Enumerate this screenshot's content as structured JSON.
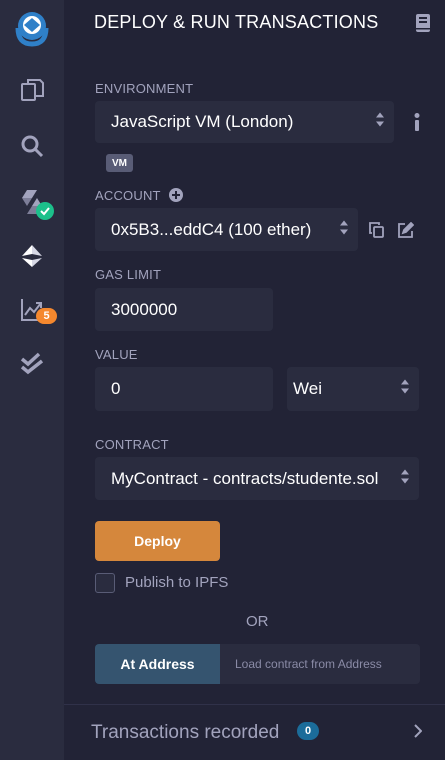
{
  "sidebar": {
    "icons": [
      "remix-logo-icon",
      "file-explorer-icon",
      "search-icon",
      "solidity-compiler-icon",
      "deploy-run-icon",
      "analysis-icon",
      "test-icon"
    ],
    "compiler_status": "check",
    "analysis_badge": "5"
  },
  "header": {
    "title": "DEPLOY & RUN TRANSACTIONS"
  },
  "environment": {
    "label": "ENVIRONMENT",
    "value": "JavaScript VM (London)",
    "badge": "VM"
  },
  "account": {
    "label": "ACCOUNT",
    "value": "0x5B3...eddC4 (100 ether)"
  },
  "gas_limit": {
    "label": "GAS LIMIT",
    "value": "3000000"
  },
  "value": {
    "label": "VALUE",
    "amount": "0",
    "unit": "Wei"
  },
  "contract": {
    "label": "CONTRACT",
    "value": "MyContract - contracts/studente.sol"
  },
  "deploy": {
    "button_label": "Deploy",
    "publish_label": "Publish to IPFS",
    "publish_checked": false
  },
  "or_label": "OR",
  "at_address": {
    "button_label": "At Address",
    "placeholder": "Load contract from Address"
  },
  "transactions": {
    "label": "Transactions recorded",
    "count": "0"
  },
  "colors": {
    "background": "#222336",
    "sidebar": "#2a2c3f",
    "deploy_button": "#d5873c",
    "at_address_button": "#35546f",
    "success": "#1cc08b",
    "warning_badge": "#f5882e",
    "count_badge": "#1b6c9a"
  }
}
